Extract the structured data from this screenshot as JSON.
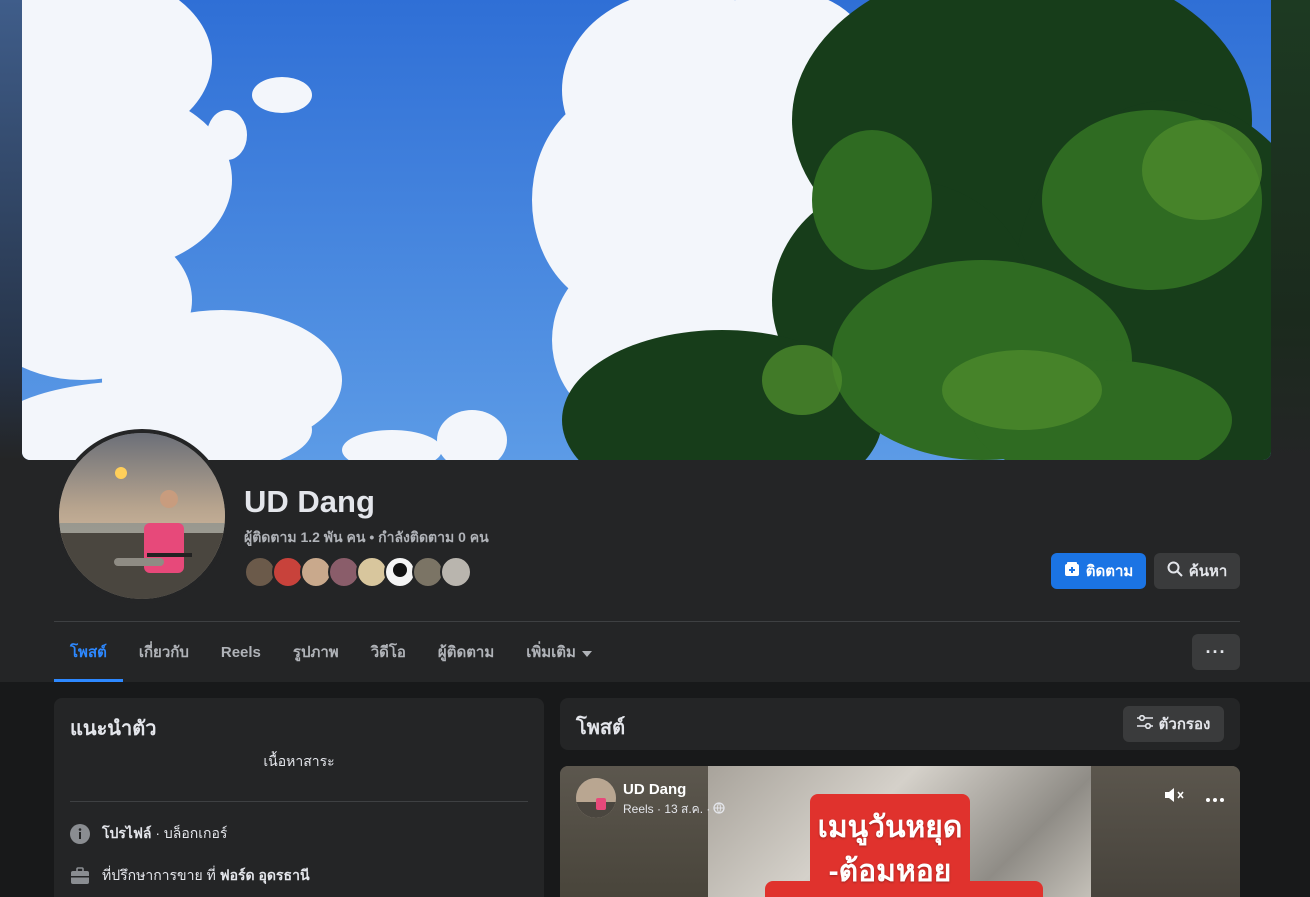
{
  "profile": {
    "name": "UD Dang",
    "stats": "ผู้ติดตาม 1.2 พัน คน • กำลังติดตาม 0 คน"
  },
  "actions": {
    "follow_label": "ติดตาม",
    "search_label": "ค้นหา"
  },
  "tabs": [
    {
      "label": "โพสต์",
      "active": true
    },
    {
      "label": "เกี่ยวกับ",
      "active": false
    },
    {
      "label": "Reels",
      "active": false
    },
    {
      "label": "รูปภาพ",
      "active": false
    },
    {
      "label": "วิดีโอ",
      "active": false
    },
    {
      "label": "ผู้ติดตาม",
      "active": false
    },
    {
      "label": "เพิ่มเติม",
      "active": false
    }
  ],
  "more_tabs_label": "···",
  "intro": {
    "title": "แนะนำตัว",
    "subtitle": "เนื้อหาสาระ",
    "rows": [
      {
        "icon": "info-icon",
        "bold": "โปรไฟล์",
        "text": " · บล็อกเกอร์"
      },
      {
        "icon": "briefcase-icon",
        "text": "ที่ปรึกษาการขาย ที่ ",
        "bold": "ฟอร์ด อุดรธานี"
      }
    ]
  },
  "posts": {
    "title": "โพสต์",
    "filter_label": "ตัวกรอง"
  },
  "post": {
    "author": "UD Dang",
    "meta": "Reels · 13 ส.ค. ·",
    "overlay_line1": "เมนูวันหยุด",
    "overlay_line2": "-ต้อมหอย"
  },
  "colors": {
    "accent": "#2d88ff",
    "follow_button": "#1b74e4",
    "surface": "#242526",
    "background": "#18191a"
  }
}
